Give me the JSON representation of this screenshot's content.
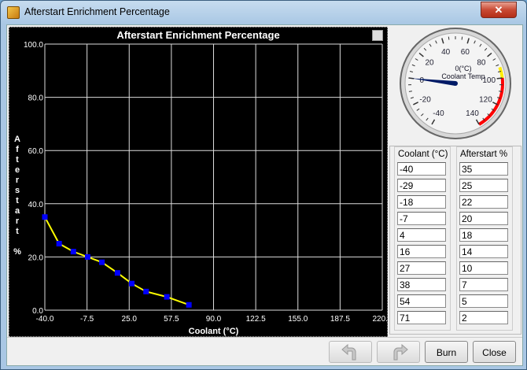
{
  "window": {
    "title": "Afterstart Enrichment Percentage",
    "close_glyph": "✕"
  },
  "gauge": {
    "value_label": "0(°C)",
    "name": "Coolant Temp",
    "value": 0,
    "ticks": [
      "-40",
      "-20",
      "0",
      "20",
      "40",
      "60",
      "80",
      "100",
      "120",
      "140"
    ]
  },
  "table": {
    "col1_header": "Coolant (°C)",
    "col2_header": "Afterstart %",
    "coolant": [
      "-40",
      "-29",
      "-18",
      "-7",
      "4",
      "16",
      "27",
      "38",
      "54",
      "71"
    ],
    "afterstart": [
      "35",
      "25",
      "22",
      "20",
      "18",
      "14",
      "10",
      "7",
      "5",
      "2"
    ]
  },
  "buttons": {
    "burn": "Burn",
    "close": "Close"
  },
  "colors": {
    "line": "#ffff00",
    "points": "#0000ff",
    "redzone": "#ff0000",
    "needle": "#001a66"
  },
  "chart_data": {
    "type": "line",
    "title": "Afterstart Enrichment Percentage",
    "xlabel": "Coolant (°C)",
    "ylabel": "Afterstart %",
    "xlim": [
      -40.0,
      220.0
    ],
    "ylim": [
      0.0,
      100.0
    ],
    "xticks": [
      "-40.0",
      "-7.5",
      "25.0",
      "57.5",
      "90.0",
      "122.5",
      "155.0",
      "187.5",
      "220.0"
    ],
    "yticks": [
      "100.0",
      "80.0",
      "60.0",
      "40.0",
      "20.0",
      "0.0"
    ],
    "grid": true,
    "x": [
      -40,
      -29,
      -18,
      -7,
      4,
      16,
      27,
      38,
      54,
      71
    ],
    "y": [
      35,
      25,
      22,
      20,
      18,
      14,
      10,
      7,
      5,
      2
    ]
  }
}
